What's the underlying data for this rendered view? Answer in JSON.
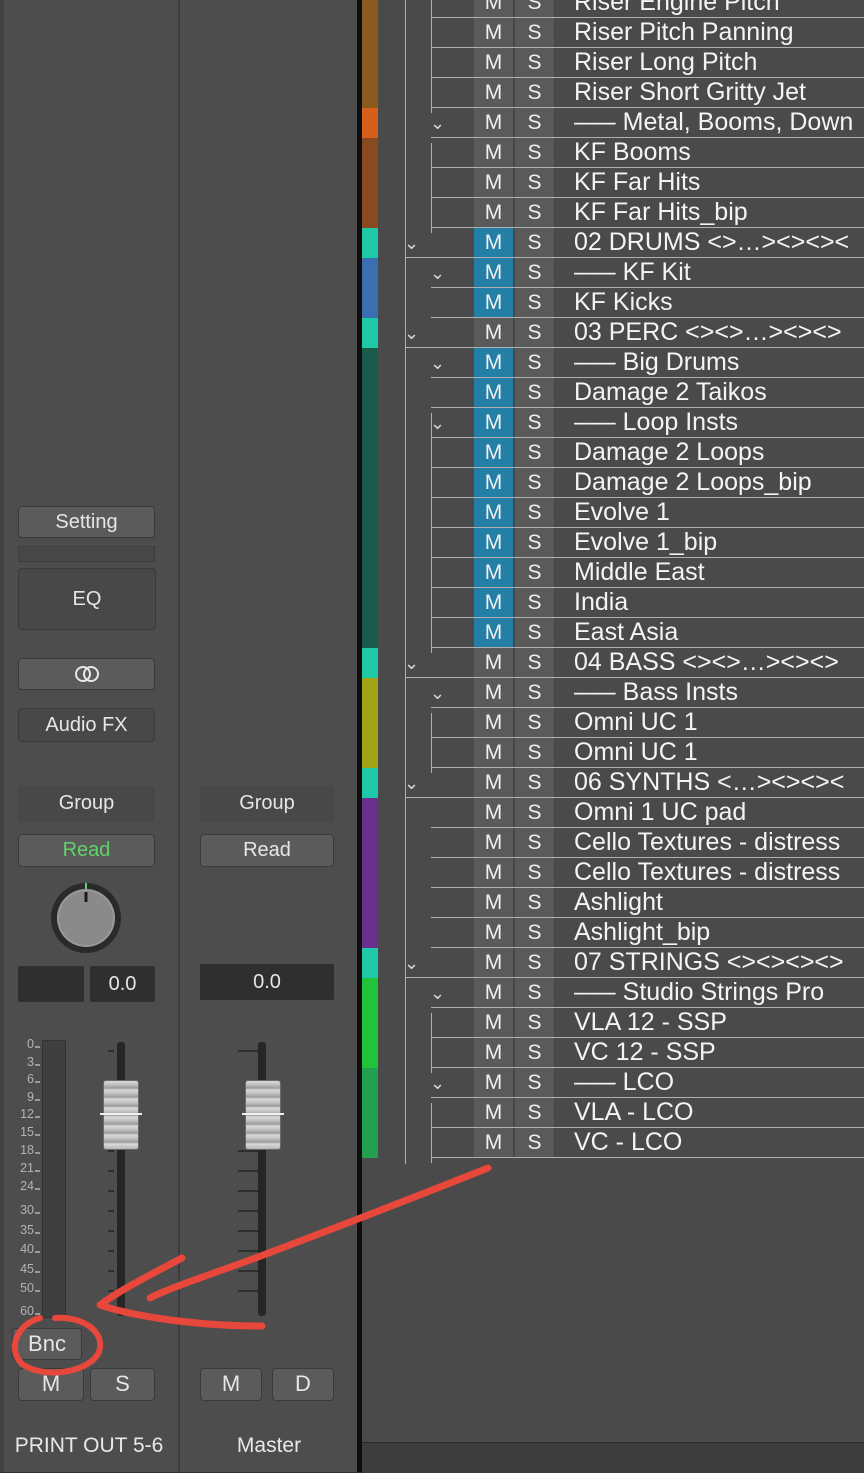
{
  "strips": [
    {
      "name": "PRINT OUT 5-6",
      "setting_label": "Setting",
      "eq_label": "EQ",
      "link_icon": "stereo-link-icon",
      "audio_fx_label": "Audio FX",
      "group_label": "Group",
      "automation_label": "Read",
      "automation_color": "#5fd36a",
      "pan_knob_icon": "pan-knob-icon",
      "volume": "0.0",
      "bounce_label": "Bnc",
      "mute_label": "M",
      "solo_label": "S"
    },
    {
      "name": "Master",
      "group_label": "Group",
      "automation_label": "Read",
      "volume": "0.0",
      "mute_label": "M",
      "dim_label": "D"
    }
  ],
  "meter_scale": [
    "0",
    "3",
    "6",
    "9",
    "12",
    "15",
    "18",
    "21",
    "24",
    "30",
    "35",
    "40",
    "45",
    "50",
    "60"
  ],
  "tracks": [
    {
      "name": "Riser Engine Pitch",
      "color": "#8a5a1e",
      "mute": "M",
      "solo": "S",
      "mute_on": false,
      "disclosure": ""
    },
    {
      "name": "Riser Pitch Panning",
      "color": "#8a5a1e",
      "mute": "M",
      "solo": "S",
      "mute_on": false,
      "disclosure": ""
    },
    {
      "name": "Riser Long Pitch",
      "color": "#8a5a1e",
      "mute": "M",
      "solo": "S",
      "mute_on": false,
      "disclosure": ""
    },
    {
      "name": "Riser Short Gritty Jet",
      "color": "#8a5a1e",
      "mute": "M",
      "solo": "S",
      "mute_on": false,
      "disclosure": ""
    },
    {
      "name": "––– Metal, Booms, Down",
      "color": "#d4601a",
      "mute": "M",
      "solo": "S",
      "mute_on": false,
      "disclosure": "⌄"
    },
    {
      "name": "KF Booms",
      "color": "#8a4a20",
      "mute": "M",
      "solo": "S",
      "mute_on": false,
      "disclosure": ""
    },
    {
      "name": "KF Far Hits",
      "color": "#8a4a20",
      "mute": "M",
      "solo": "S",
      "mute_on": false,
      "disclosure": ""
    },
    {
      "name": "KF Far Hits_bip",
      "color": "#8a4a20",
      "mute": "M",
      "solo": "S",
      "mute_on": false,
      "disclosure": ""
    },
    {
      "name": "02 DRUMS  <>…><><><",
      "color": "#1fc9a8",
      "mute": "M",
      "solo": "S",
      "mute_on": true,
      "disclosure": "⌄"
    },
    {
      "name": "––– KF Kit",
      "color": "#3a6fb0",
      "mute": "M",
      "solo": "S",
      "mute_on": true,
      "disclosure": "⌄"
    },
    {
      "name": "KF Kicks",
      "color": "#3a6fb0",
      "mute": "M",
      "solo": "S",
      "mute_on": true,
      "disclosure": ""
    },
    {
      "name": "03 PERC  <><>…><><>",
      "color": "#1fc9a8",
      "mute": "M",
      "solo": "S",
      "mute_on": false,
      "disclosure": "⌄"
    },
    {
      "name": "––– Big Drums",
      "color": "#1a5a4a",
      "mute": "M",
      "solo": "S",
      "mute_on": true,
      "disclosure": "⌄"
    },
    {
      "name": "Damage 2 Taikos",
      "color": "#1a5a4a",
      "mute": "M",
      "solo": "S",
      "mute_on": true,
      "disclosure": ""
    },
    {
      "name": "––– Loop Insts",
      "color": "#1a5a4a",
      "mute": "M",
      "solo": "S",
      "mute_on": true,
      "disclosure": "⌄"
    },
    {
      "name": "Damage 2 Loops",
      "color": "#1a5a4a",
      "mute": "M",
      "solo": "S",
      "mute_on": true,
      "disclosure": ""
    },
    {
      "name": "Damage 2 Loops_bip",
      "color": "#1a5a4a",
      "mute": "M",
      "solo": "S",
      "mute_on": true,
      "disclosure": ""
    },
    {
      "name": "Evolve 1",
      "color": "#1a5a4a",
      "mute": "M",
      "solo": "S",
      "mute_on": true,
      "disclosure": ""
    },
    {
      "name": "Evolve 1_bip",
      "color": "#1a5a4a",
      "mute": "M",
      "solo": "S",
      "mute_on": true,
      "disclosure": ""
    },
    {
      "name": "Middle East",
      "color": "#1a5a4a",
      "mute": "M",
      "solo": "S",
      "mute_on": true,
      "disclosure": ""
    },
    {
      "name": "India",
      "color": "#1a5a4a",
      "mute": "M",
      "solo": "S",
      "mute_on": true,
      "disclosure": ""
    },
    {
      "name": "East Asia",
      "color": "#1a5a4a",
      "mute": "M",
      "solo": "S",
      "mute_on": true,
      "disclosure": ""
    },
    {
      "name": "04 BASS  <><>…><><>",
      "color": "#1fc9a8",
      "mute": "M",
      "solo": "S",
      "mute_on": false,
      "disclosure": "⌄"
    },
    {
      "name": "––– Bass Insts",
      "color": "#a3a31a",
      "mute": "M",
      "solo": "S",
      "mute_on": false,
      "disclosure": "⌄"
    },
    {
      "name": "Omni UC 1",
      "color": "#a3a31a",
      "mute": "M",
      "solo": "S",
      "mute_on": false,
      "disclosure": ""
    },
    {
      "name": "Omni UC 1",
      "color": "#a3a31a",
      "mute": "M",
      "solo": "S",
      "mute_on": false,
      "disclosure": ""
    },
    {
      "name": "06 SYNTHS  <…><><><",
      "color": "#1fc9a8",
      "mute": "M",
      "solo": "S",
      "mute_on": false,
      "disclosure": "⌄"
    },
    {
      "name": "Omni 1 UC pad",
      "color": "#6a2f8f",
      "mute": "M",
      "solo": "S",
      "mute_on": false,
      "disclosure": ""
    },
    {
      "name": "Cello Textures - distress",
      "color": "#6a2f8f",
      "mute": "M",
      "solo": "S",
      "mute_on": false,
      "disclosure": ""
    },
    {
      "name": "Cello Textures - distress",
      "color": "#6a2f8f",
      "mute": "M",
      "solo": "S",
      "mute_on": false,
      "disclosure": ""
    },
    {
      "name": "Ashlight",
      "color": "#6a2f8f",
      "mute": "M",
      "solo": "S",
      "mute_on": false,
      "disclosure": ""
    },
    {
      "name": "Ashlight_bip",
      "color": "#6a2f8f",
      "mute": "M",
      "solo": "S",
      "mute_on": false,
      "disclosure": ""
    },
    {
      "name": "07 STRINGS  <><><><>",
      "color": "#1fc9a8",
      "mute": "M",
      "solo": "S",
      "mute_on": false,
      "disclosure": "⌄"
    },
    {
      "name": "––– Studio Strings Pro",
      "color": "#22c23a",
      "mute": "M",
      "solo": "S",
      "mute_on": false,
      "disclosure": "⌄"
    },
    {
      "name": "VLA 12 - SSP",
      "color": "#22c23a",
      "mute": "M",
      "solo": "S",
      "mute_on": false,
      "disclosure": ""
    },
    {
      "name": "VC 12 - SSP",
      "color": "#22c23a",
      "mute": "M",
      "solo": "S",
      "mute_on": false,
      "disclosure": ""
    },
    {
      "name": "––– LCO",
      "color": "#20a050",
      "mute": "M",
      "solo": "S",
      "mute_on": false,
      "disclosure": "⌄"
    },
    {
      "name": "VLA - LCO",
      "color": "#20a050",
      "mute": "M",
      "solo": "S",
      "mute_on": false,
      "disclosure": ""
    },
    {
      "name": "VC - LCO",
      "color": "#20a050",
      "mute": "M",
      "solo": "S",
      "mute_on": false,
      "disclosure": ""
    }
  ],
  "annotation": {
    "color": "#e8473b",
    "icon": "hand-drawn-arrow-and-circle"
  }
}
